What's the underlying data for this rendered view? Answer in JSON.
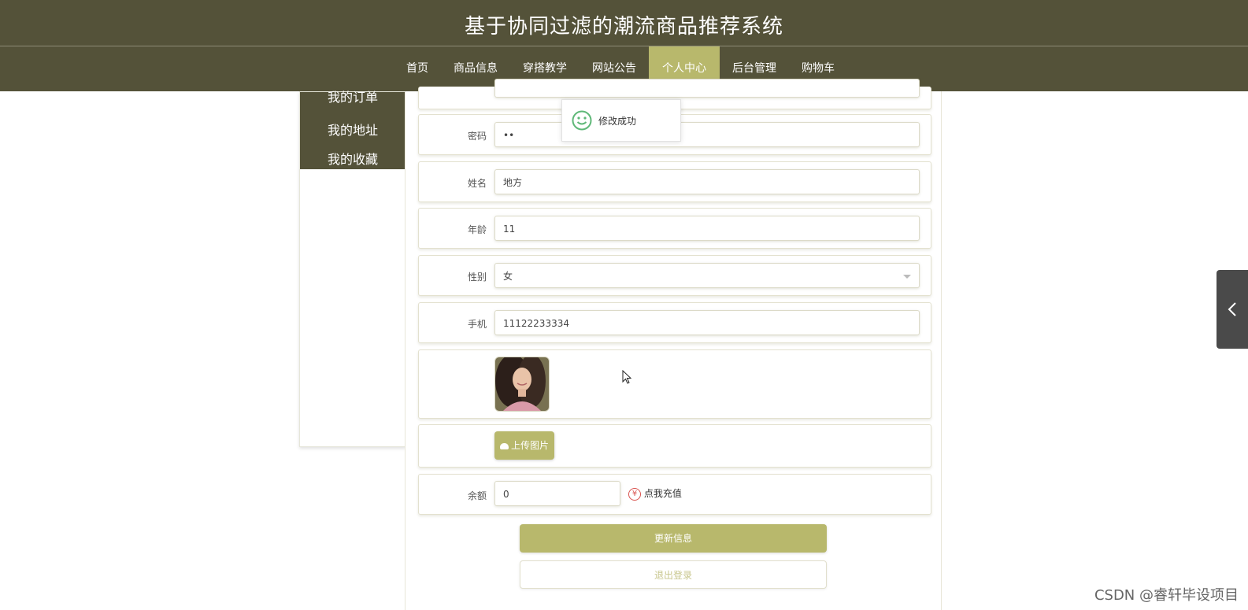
{
  "site": {
    "title": "基于协同过滤的潮流商品推荐系统"
  },
  "nav": {
    "items": [
      "首页",
      "商品信息",
      "穿搭教学",
      "网站公告",
      "个人中心",
      "后台管理",
      "购物车"
    ],
    "active_index": 4
  },
  "sidebar": {
    "items": [
      "我的订单",
      "我的地址",
      "我的收藏"
    ]
  },
  "toast": {
    "message": "修改成功",
    "icon": "smile-icon"
  },
  "form": {
    "password": {
      "label": "密码",
      "value": "••"
    },
    "name": {
      "label": "姓名",
      "value": "地方"
    },
    "age": {
      "label": "年龄",
      "value": "11"
    },
    "gender": {
      "label": "性别",
      "value": "女"
    },
    "phone": {
      "label": "手机",
      "value": "11122233334"
    },
    "upload_label": "上传图片",
    "balance": {
      "label": "余额",
      "value": "0"
    },
    "recharge_label": "点我充值",
    "update_label": "更新信息",
    "logout_label": "退出登录"
  },
  "watermark": "CSDN @睿轩毕设项目",
  "colors": {
    "header_bg": "#545239",
    "accent": "#b8b86c"
  }
}
